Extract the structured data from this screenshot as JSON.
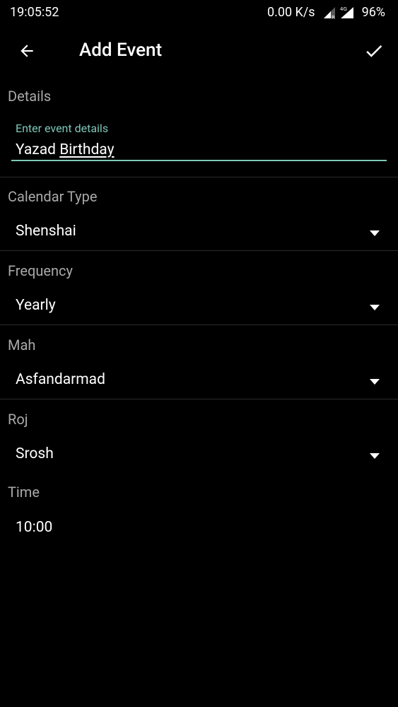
{
  "status_bar": {
    "time": "19:05:52",
    "network_speed": "0.00 K/s",
    "network_type": "4G",
    "battery": "96%"
  },
  "app_bar": {
    "title": "Add Event",
    "back_icon": "arrow-back-icon",
    "confirm_icon": "check-icon"
  },
  "details": {
    "label": "Details",
    "hint": "Enter event details",
    "value_first": "Yazad",
    "value_second": "Birthday"
  },
  "calendar_type": {
    "label": "Calendar Type",
    "selected": "Shenshai"
  },
  "frequency": {
    "label": "Frequency",
    "selected": "Yearly"
  },
  "mah": {
    "label": "Mah",
    "selected": "Asfandarmad"
  },
  "roj": {
    "label": "Roj",
    "selected": "Srosh"
  },
  "time": {
    "label": "Time",
    "value": "10:00"
  },
  "colors": {
    "background": "#000000",
    "accent": "#7ec8b8",
    "label": "#a9a9a9",
    "text": "#ffffff"
  }
}
